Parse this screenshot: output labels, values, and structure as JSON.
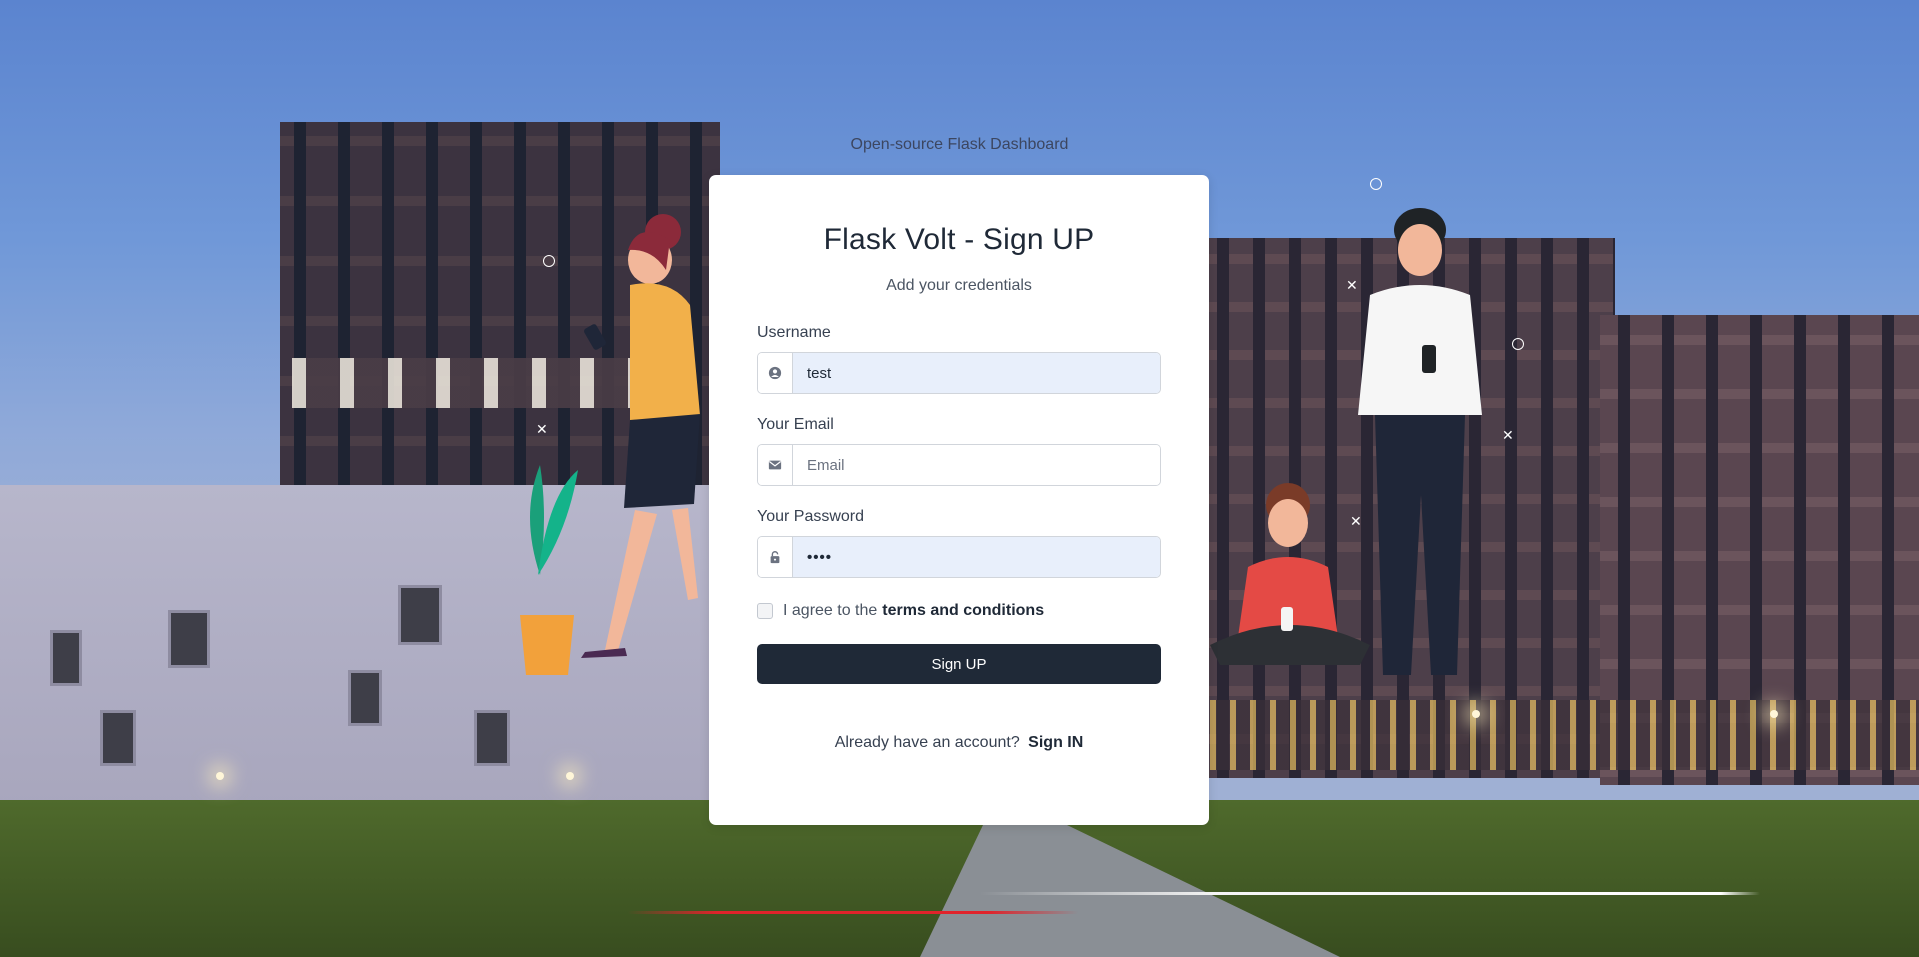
{
  "tagline": "Open-source Flask Dashboard",
  "card": {
    "title": "Flask Volt - Sign UP",
    "subtitle": "Add your credentials"
  },
  "form": {
    "username": {
      "label": "Username",
      "value": "test",
      "icon": "user-circle-icon"
    },
    "email": {
      "label": "Your Email",
      "value": "",
      "placeholder": "Email",
      "icon": "envelope-icon"
    },
    "password": {
      "label": "Your Password",
      "value": "••••",
      "icon": "unlock-icon"
    },
    "terms": {
      "checked": false,
      "prefix": "I agree to the",
      "link": "terms and conditions"
    },
    "submit_label": "Sign UP"
  },
  "footer": {
    "text": "Already have an account?",
    "link": "Sign IN"
  },
  "colors": {
    "button": "#1f2937",
    "autofill_bg": "#e8effb",
    "card": "#ffffff"
  }
}
